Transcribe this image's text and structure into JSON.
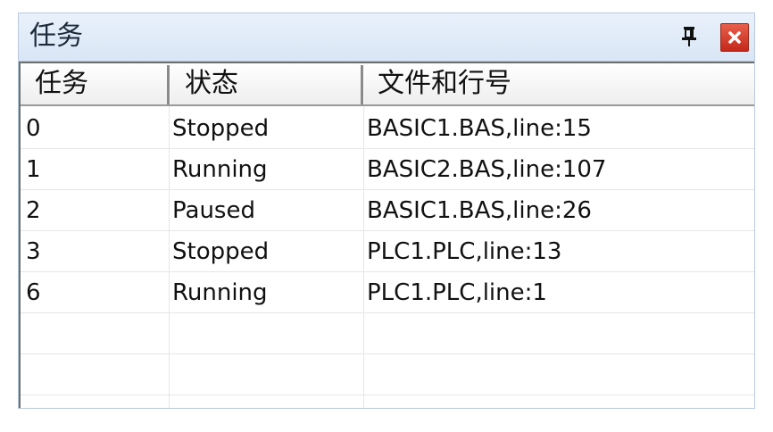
{
  "window": {
    "title": "任务"
  },
  "columns": [
    "任务",
    "状态",
    "文件和行号"
  ],
  "rows": [
    {
      "task": "0",
      "status": "Stopped",
      "file": "BASIC1.BAS,line:15"
    },
    {
      "task": "1",
      "status": "Running",
      "file": "BASIC2.BAS,line:107"
    },
    {
      "task": "2",
      "status": "Paused",
      "file": "BASIC1.BAS,line:26"
    },
    {
      "task": "3",
      "status": "Stopped",
      "file": "PLC1.PLC,line:13"
    },
    {
      "task": "6",
      "status": "Running",
      "file": "PLC1.PLC,line:1"
    },
    {
      "task": "",
      "status": "",
      "file": ""
    },
    {
      "task": "",
      "status": "",
      "file": ""
    }
  ],
  "icons": {
    "pin": "pin-icon",
    "close": "close-icon"
  },
  "colors": {
    "close_button": "#d8412e",
    "titlebar": "#dde8f6"
  }
}
